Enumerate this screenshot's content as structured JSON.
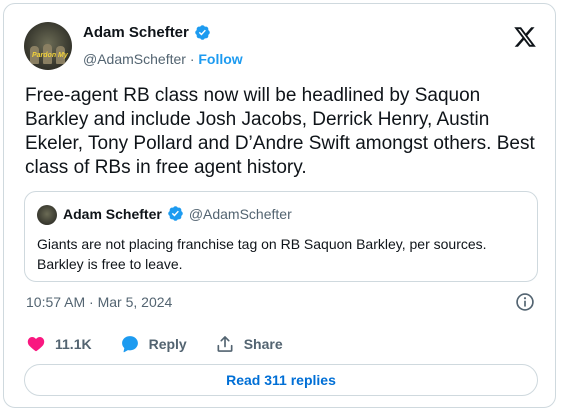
{
  "author": {
    "name": "Adam Schefter",
    "handle": "@AdamSchefter",
    "separator": "·",
    "follow_label": "Follow",
    "avatar_text": "Pardon My"
  },
  "tweet": {
    "text": "Free-agent RB class now will be headlined by Saquon Barkley and include Josh Jacobs, Derrick Henry, Austin Ekeler, Tony Pollard and D’Andre Swift amongst others. Best class of RBs in free agent history.",
    "timestamp": "10:57 AM · Mar 5, 2024"
  },
  "quoted": {
    "name": "Adam Schefter",
    "handle": "@AdamSchefter",
    "text": "Giants are not placing franchise tag on RB Saquon Barkley, per sources. Barkley is free  to leave."
  },
  "actions": {
    "likes": "11.1K",
    "reply_label": "Reply",
    "share_label": "Share"
  },
  "replies_button": "Read 311 replies",
  "colors": {
    "accent": "#1d9bf0",
    "like": "#f91880",
    "reply_bubble": "#1d9bf0",
    "link": "#006fd6"
  },
  "icons": [
    "verified-badge-icon",
    "x-logo-icon",
    "info-icon",
    "heart-icon",
    "reply-bubble-icon",
    "share-icon"
  ]
}
